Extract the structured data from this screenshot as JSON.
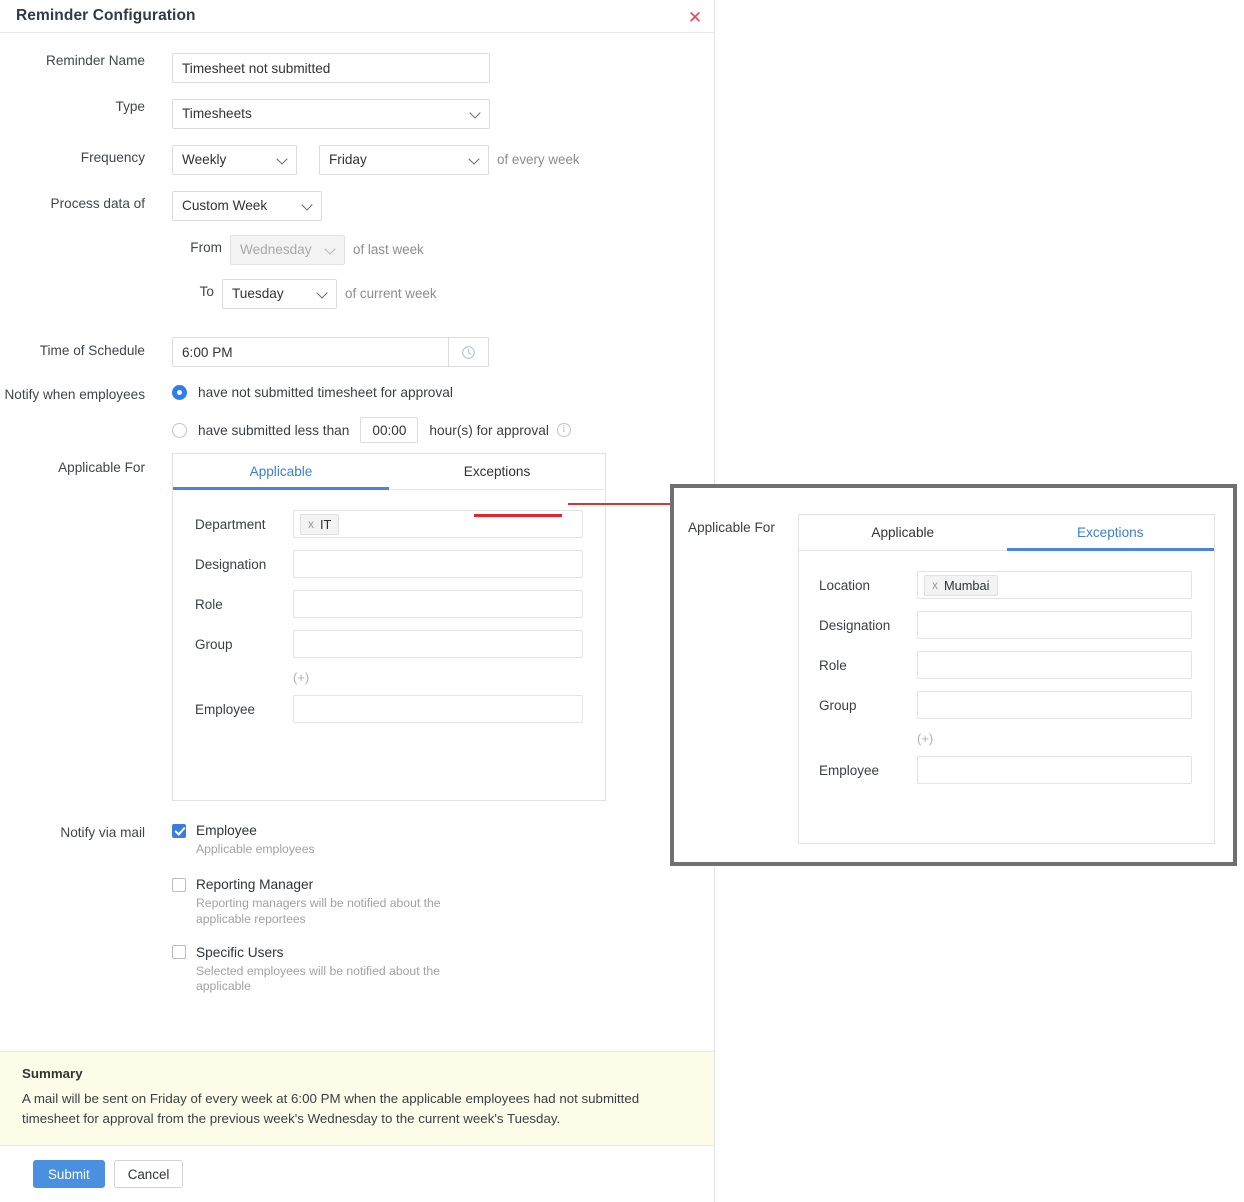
{
  "dialog": {
    "title": "Reminder Configuration",
    "close_icon": "close-icon"
  },
  "form": {
    "reminder_name": {
      "label": "Reminder Name",
      "value": "Timesheet not submitted",
      "placeholder": ""
    },
    "type": {
      "label": "Type",
      "value": "Timesheets"
    },
    "frequency": {
      "label": "Frequency",
      "value": "Weekly",
      "day_value": "Friday",
      "suffix": "of every week"
    },
    "process_data_of": {
      "label": "Process data of",
      "value": "Custom Week",
      "from_label": "From",
      "from_value": "Wednesday",
      "from_suffix": "of last week",
      "to_label": "To",
      "to_value": "Tuesday",
      "to_suffix": "of current week"
    },
    "time_of_schedule": {
      "label": "Time of Schedule",
      "value": "6:00 PM",
      "icon": "clock-icon"
    },
    "notify_when": {
      "label": "Notify when employees",
      "option1": "have not submitted timesheet for approval",
      "option1_selected": true,
      "option2_prefix": "have submitted less than",
      "option2_value": "00:00",
      "option2_suffix": "hour(s) for approval",
      "option2_selected": false,
      "info_icon": "info-icon"
    },
    "applicable_for": {
      "label": "Applicable For",
      "tabs": [
        {
          "label": "Applicable",
          "active": true
        },
        {
          "label": "Exceptions",
          "active": false
        }
      ],
      "fields": [
        {
          "label": "Department",
          "chip": "IT",
          "chip_remove": "x"
        },
        {
          "label": "Designation",
          "chip": "",
          "chip_remove": ""
        },
        {
          "label": "Role",
          "chip": "",
          "chip_remove": ""
        },
        {
          "label": "Group",
          "chip": "",
          "chip_remove": ""
        }
      ],
      "add_more": "(+)",
      "employee": {
        "label": "Employee",
        "value": ""
      }
    },
    "notify_via_mail": {
      "label": "Notify via mail",
      "options": [
        {
          "label": "Employee",
          "checked": true,
          "help": "Applicable employees"
        },
        {
          "label": "Reporting Manager",
          "checked": false,
          "help": "Reporting managers will be notified about the applicable reportees"
        },
        {
          "label": "Specific Users",
          "checked": false,
          "help": "Selected employees will be notified about the applicable"
        }
      ]
    }
  },
  "summary": {
    "title": "Summary",
    "text": "A mail will be sent on Friday of every week at 6:00 PM when the applicable employees had not submitted timesheet for approval from the previous week's Wednesday to the current week's Tuesday."
  },
  "footer": {
    "submit_label": "Submit",
    "cancel_label": "Cancel"
  },
  "callout": {
    "label": "Applicable For",
    "tabs": [
      {
        "label": "Applicable",
        "active": false
      },
      {
        "label": "Exceptions",
        "active": true
      }
    ],
    "fields": [
      {
        "label": "Location",
        "chip": "Mumbai",
        "chip_remove": "x"
      },
      {
        "label": "Designation",
        "chip": "",
        "chip_remove": ""
      },
      {
        "label": "Role",
        "chip": "",
        "chip_remove": ""
      },
      {
        "label": "Group",
        "chip": "",
        "chip_remove": ""
      }
    ],
    "add_more": "(+)",
    "employee": {
      "label": "Employee",
      "value": ""
    }
  },
  "colors": {
    "accent_blue": "#4a86d6",
    "annotation_red": "#e8242a",
    "summary_bg": "#fcfce8",
    "close_red": "#ef4256",
    "callout_border": "#6e7073"
  }
}
